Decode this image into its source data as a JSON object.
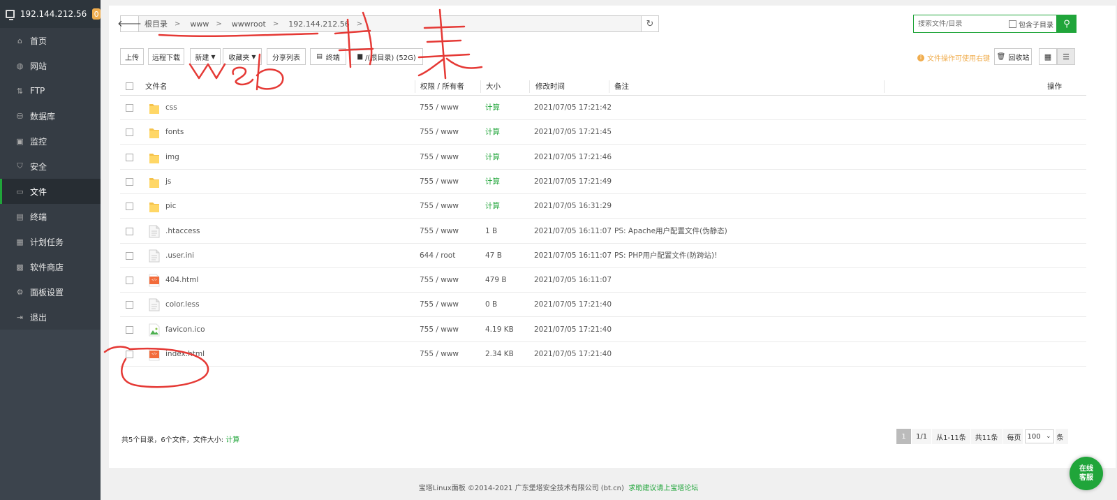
{
  "sidebar": {
    "host": "192.144.212.56",
    "badge": "0",
    "items": [
      {
        "label": "首页",
        "icon": "home-icon",
        "glyph": "⌂"
      },
      {
        "label": "网站",
        "icon": "globe-icon",
        "glyph": "◍"
      },
      {
        "label": "FTP",
        "icon": "ftp-icon",
        "glyph": "⇅"
      },
      {
        "label": "数据库",
        "icon": "database-icon",
        "glyph": "⛁"
      },
      {
        "label": "监控",
        "icon": "monitor-icon",
        "glyph": "▣"
      },
      {
        "label": "安全",
        "icon": "shield-icon",
        "glyph": "⛉"
      },
      {
        "label": "文件",
        "icon": "folder-icon",
        "glyph": "▭"
      },
      {
        "label": "终端",
        "icon": "terminal-icon",
        "glyph": "▤"
      },
      {
        "label": "计划任务",
        "icon": "calendar-icon",
        "glyph": "▦"
      },
      {
        "label": "软件商店",
        "icon": "apps-icon",
        "glyph": "▩"
      },
      {
        "label": "面板设置",
        "icon": "gear-icon",
        "glyph": "⚙"
      },
      {
        "label": "退出",
        "icon": "logout-icon",
        "glyph": "⇥"
      }
    ],
    "active_index": 6
  },
  "path": {
    "back_glyph": "🡐",
    "crumbs": [
      "根目录",
      "www",
      "wwwroot",
      "192.144.212.56"
    ],
    "refresh_glyph": "↻"
  },
  "search": {
    "placeholder": "搜索文件/目录",
    "sub_label": "包含子目录",
    "button_glyph": "⚲"
  },
  "toolbar": {
    "upload": "上传",
    "remote_download": "远程下载",
    "new": "新建",
    "favorites": "收藏夹",
    "share_list": "分享列表",
    "terminal": "终端",
    "disk": "/(根目录) (52G)",
    "tip": "文件操作可使用右键",
    "recycle": "回收站"
  },
  "table": {
    "headers": {
      "name": "文件名",
      "perm": "权限 / 所有者",
      "size": "大小",
      "mtime": "修改时间",
      "remark": "备注",
      "ops": "操作"
    },
    "rows": [
      {
        "type": "folder",
        "name": "css",
        "perm": "755 / www",
        "size": "计算",
        "mtime": "2021/07/05 17:21:42",
        "remark": ""
      },
      {
        "type": "folder",
        "name": "fonts",
        "perm": "755 / www",
        "size": "计算",
        "mtime": "2021/07/05 17:21:45",
        "remark": ""
      },
      {
        "type": "folder",
        "name": "img",
        "perm": "755 / www",
        "size": "计算",
        "mtime": "2021/07/05 17:21:46",
        "remark": ""
      },
      {
        "type": "folder",
        "name": "js",
        "perm": "755 / www",
        "size": "计算",
        "mtime": "2021/07/05 17:21:49",
        "remark": ""
      },
      {
        "type": "folder",
        "name": "pic",
        "perm": "755 / www",
        "size": "计算",
        "mtime": "2021/07/05 16:31:29",
        "remark": ""
      },
      {
        "type": "text",
        "name": ".htaccess",
        "perm": "755 / www",
        "size": "1 B",
        "mtime": "2021/07/05 16:11:07",
        "remark": "PS: Apache用户配置文件(伪静态)"
      },
      {
        "type": "text",
        "name": ".user.ini",
        "perm": "644 / root",
        "size": "47 B",
        "mtime": "2021/07/05 16:11:07",
        "remark": "PS: PHP用户配置文件(防跨站)!"
      },
      {
        "type": "html",
        "name": "404.html",
        "perm": "755 / www",
        "size": "479 B",
        "mtime": "2021/07/05 16:11:07",
        "remark": ""
      },
      {
        "type": "text",
        "name": "color.less",
        "perm": "755 / www",
        "size": "0 B",
        "mtime": "2021/07/05 17:21:40",
        "remark": ""
      },
      {
        "type": "image",
        "name": "favicon.ico",
        "perm": "755 / www",
        "size": "4.19 KB",
        "mtime": "2021/07/05 17:21:40",
        "remark": ""
      },
      {
        "type": "html",
        "name": "index.html",
        "perm": "755 / www",
        "size": "2.34 KB",
        "mtime": "2021/07/05 17:21:40",
        "remark": ""
      }
    ]
  },
  "summary": {
    "text": "共5个目录，6个文件，文件大小: ",
    "calc": "计算"
  },
  "pager": {
    "current": "1",
    "pages": "1/1",
    "range": "从1-11条",
    "total": "共11条",
    "per_page_label": "每页",
    "per_page_value": "100",
    "unit": "条"
  },
  "footer": {
    "copyright": "宝塔Linux面板 ©2014-2021 广东堡塔安全技术有限公司 (bt.cn)",
    "forum_link": "求助建议请上宝塔论坛"
  },
  "chat": {
    "line1": "在线",
    "line2": "客服"
  },
  "colors": {
    "accent": "#20a53a",
    "warning": "#f0ad4e",
    "sidebar": "#3c444d",
    "annotation": "#e53935"
  }
}
